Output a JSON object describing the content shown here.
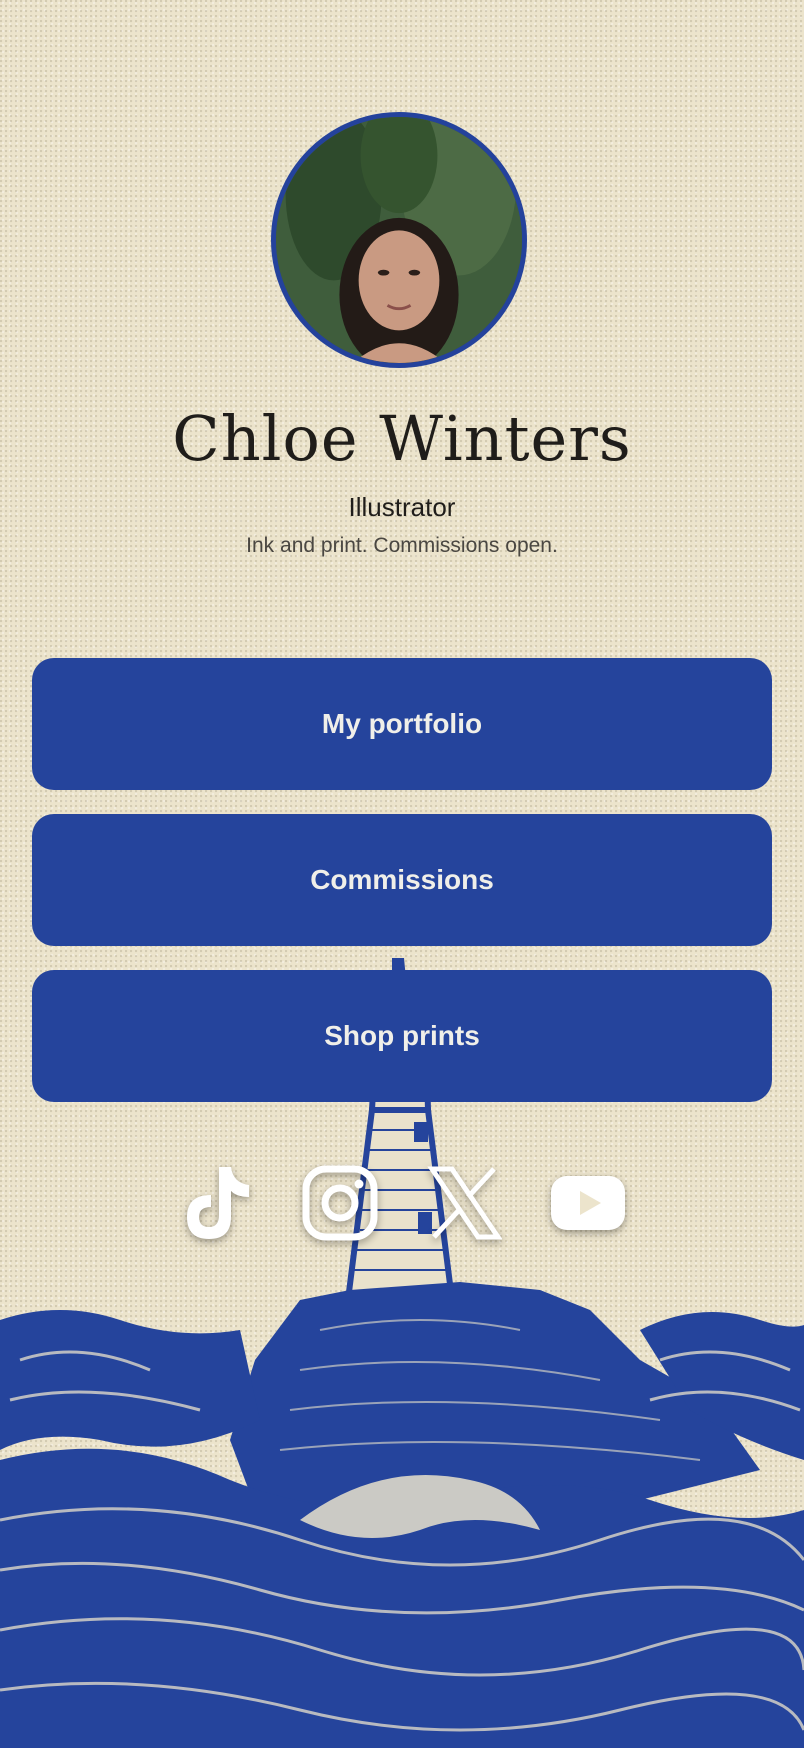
{
  "profile": {
    "name": "Chloe Winters",
    "title": "Illustrator",
    "bio": "Ink and print. Commissions open."
  },
  "links": [
    {
      "label": "My portfolio"
    },
    {
      "label": "Commissions"
    },
    {
      "label": "Shop prints"
    }
  ],
  "socials": [
    {
      "icon": "tiktok-icon"
    },
    {
      "icon": "instagram-icon"
    },
    {
      "icon": "x-icon"
    },
    {
      "icon": "youtube-icon"
    }
  ],
  "colors": {
    "accent": "#25449c",
    "background": "#ece4cc",
    "text": "#1f1d1a",
    "button_text": "#f0efe9"
  }
}
